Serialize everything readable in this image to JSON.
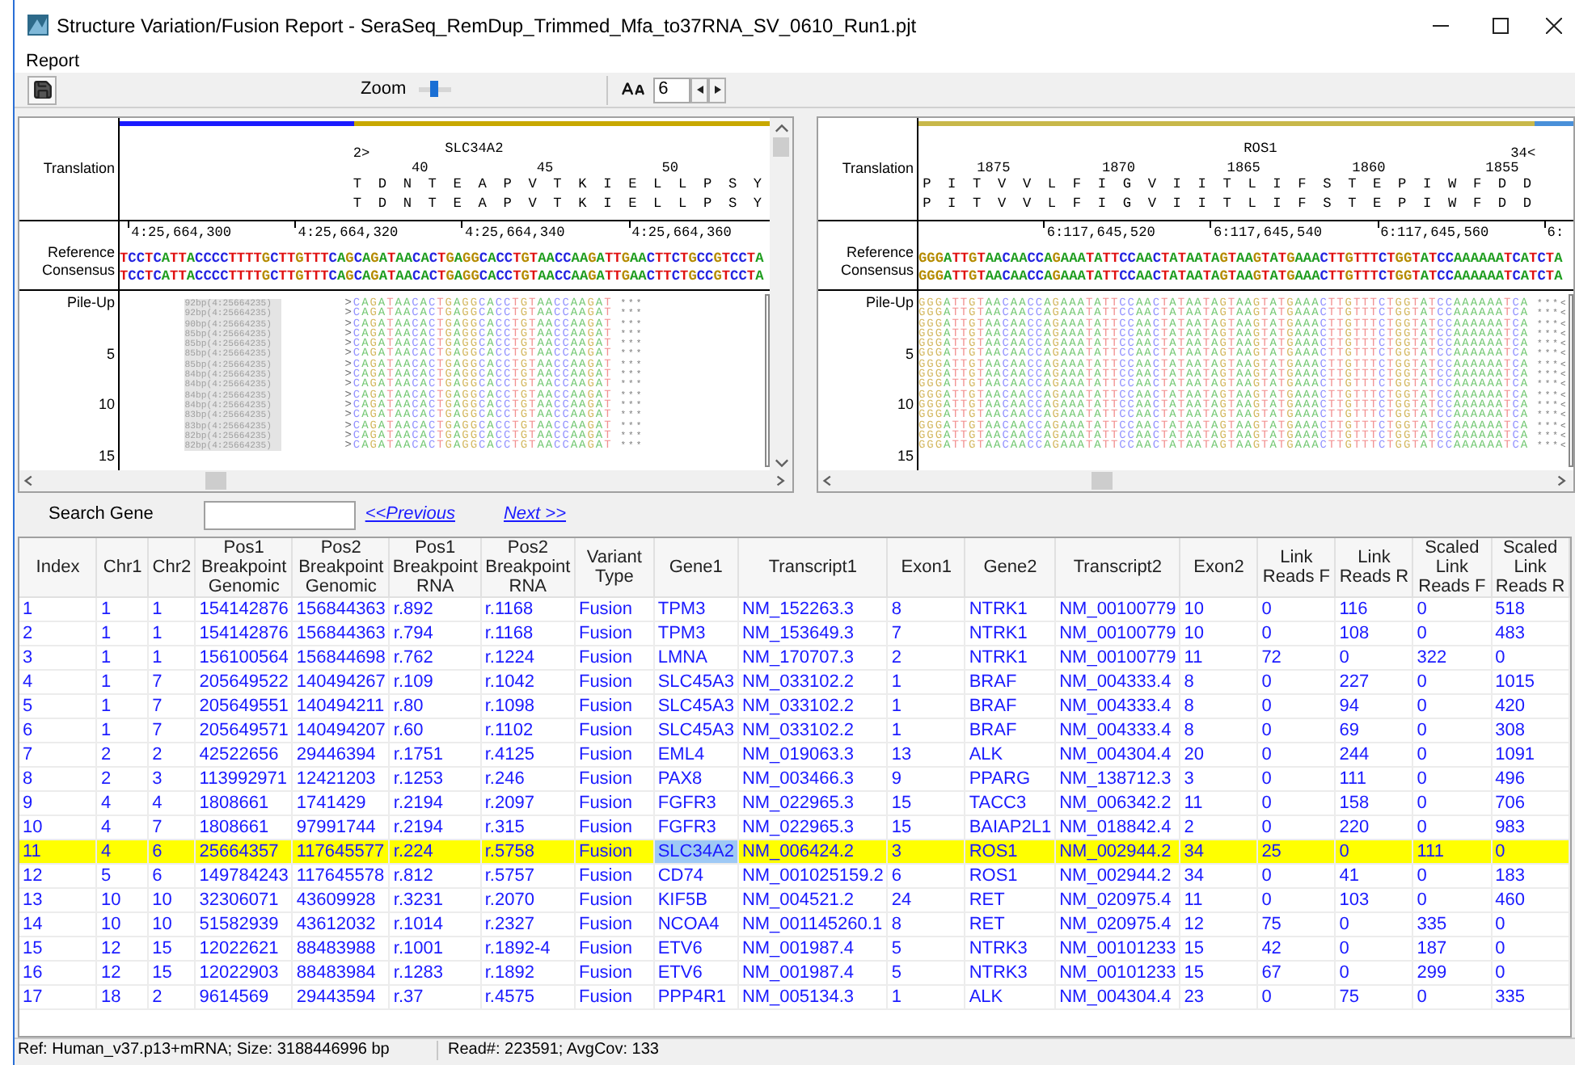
{
  "window": {
    "title": "Structure Variation/Fusion Report - SeraSeq_RemDup_Trimmed_Mfa_to37RNA_SV_0610_Run1.pjt"
  },
  "menu": [
    "Report"
  ],
  "toolbar": {
    "zoom_label": "Zoom",
    "zoom": {
      "level": 0.45
    },
    "font_size": {
      "value": "6"
    }
  },
  "panels": [
    {
      "translation_label": "Translation",
      "coverage": [
        {
          "color": "#1a1aff",
          "level": 0.36
        },
        {
          "color": "#c8a800",
          "level": 0.64
        }
      ],
      "marker": "2>",
      "gene": "SLC34A2",
      "numbers": [
        "40",
        "45",
        "50"
      ],
      "aa_rows": [
        "T D N T E A P V T K I E L L P S Y",
        "T D N T E A P V T K I E L L P S Y"
      ],
      "reference_label": "Reference",
      "consensus_label": "Consensus",
      "ruler": [
        "4:25,664,300",
        "4:25,664,320",
        "4:25,664,340",
        "4:25,664,360"
      ],
      "reference": "TCCTCATTACCCCTTTTGCTTGTTTCAGCAGATAACACTGAGGCACCTGTAACCAAGATTGAACTTCTGCCGTCCTA",
      "consensus": "TCCTCATTACCCCTTTTGCTTGTTTCAGCAGATAACACTGAGGCACCTGTAACCAAGATTGAACTTCTGCCGTCCTA",
      "pileup_label": "Pile-Up",
      "pileup_ticks": [
        "5",
        "10",
        "15"
      ],
      "reads": [
        {
          "label": "92bp(4:25664235)",
          "sequence": ">CAGATAACACTGAGGCACCTGTAACCAAGAT",
          "tail": "***"
        },
        {
          "label": "92bp(4:25664235)",
          "sequence": ">CAGATAACACTGAGGCACCTGTAACCAAGAT",
          "tail": "***"
        },
        {
          "label": "90bp(4:25664235)",
          "sequence": ">CAGATAACACTGAGGCACCTGTAACCAAGAT",
          "tail": "***"
        },
        {
          "label": "85bp(4:25664235)",
          "sequence": ">CAGATAACACTGAGGCACCTGTAACCAAGAT",
          "tail": "***"
        },
        {
          "label": "85bp(4:25664235)",
          "sequence": ">CAGATAACACTGAGGCACCTGTAACCAAGAT",
          "tail": "***"
        },
        {
          "label": "85bp(4:25664235)",
          "sequence": ">CAGATAACACTGAGGCACCTGTAACCAAGAT",
          "tail": "***"
        },
        {
          "label": "85bp(4:25664235)",
          "sequence": ">CAGATAACACTGAGGCACCTGTAACCAAGAT",
          "tail": "***"
        },
        {
          "label": "84bp(4:25664235)",
          "sequence": ">CAGATAACACTGAGGCACCTGTAACCAAGAT",
          "tail": "***"
        },
        {
          "label": "84bp(4:25664235)",
          "sequence": ">CAGATAACACTGAGGCACCTGTAACCAAGAT",
          "tail": "***"
        },
        {
          "label": "84bp(4:25664235)",
          "sequence": ">CAGATAACACTGAGGCACCTGTAACCAAGAT",
          "tail": "***"
        },
        {
          "label": "84bp(4:25664235)",
          "sequence": ">CAGATAACACTGAGGCACCTGTAACCAAGAT",
          "tail": "***"
        },
        {
          "label": "83bp(4:25664235)",
          "sequence": ">CAGATAACACTGAGGCACCTGTAACCAAGAT",
          "tail": "***"
        },
        {
          "label": "83bp(4:25664235)",
          "sequence": ">CAGATAACACTGAGGCACCTGTAACCAAGAT",
          "tail": "***"
        },
        {
          "label": "82bp(4:25664235)",
          "sequence": ">CAGATAACACTGAGGCACCTGTAACCAAGAT",
          "tail": "***"
        },
        {
          "label": "82bp(4:25664235)",
          "sequence": ">CAGATAACACTGAGGCACCTGTAACCAAGAT",
          "tail": "***"
        }
      ]
    },
    {
      "translation_label": "Translation",
      "coverage": [
        {
          "color": "#c8b84a",
          "level": 0.94
        },
        {
          "color": "#4a90d9",
          "level": 0.06
        }
      ],
      "gene": "ROS1",
      "end_marker": "34<",
      "numbers": [
        "1875",
        "1870",
        "1865",
        "1860",
        "1855"
      ],
      "aa_rows": [
        "P I T V V L F I G V I I T L I F S T E P I W F D D",
        "P I T V V L F I G V I I T L I F S T E P I W F D D"
      ],
      "reference_label": "Reference",
      "consensus_label": "Consensus",
      "ruler": [
        "6:117,645,520",
        "6:117,645,540",
        "6:117,645,560",
        "6:"
      ],
      "reference": "GGGATTGTAACAACCAGAAATATTCCAACTATAATAGTAAGTATGAAACTTGTTTCTGGTATCCAAAAAATCATCTA",
      "consensus": "GGGATTGTAACAACCAGAAATATTCCAACTATAATAGTAAGTATGAAACTTGTTTCTGGTATCCAAAAAATCATCTA",
      "pileup_label": "Pile-Up",
      "pileup_ticks": [
        "5",
        "10",
        "15"
      ],
      "reads": [
        {
          "sequence": "GGGATTGTAACAACCAGAAATATTCCAACTATAATAGTAAGTATGAAACTTGTTTCTGGTATCCAAAAAATCA",
          "tail": "***<"
        },
        {
          "sequence": "GGGATTGTAACAACCAGAAATATTCCAACTATAATAGTAAGTATGAAACTTGTTTCTGGTATCCAAAAAATCA",
          "tail": "***<"
        },
        {
          "sequence": "GGGATTGTAACAACCAGAAATATTCCAACTATAATAGTAAGTATGAAACTTGTTTCTGGTATCCAAAAAATCA",
          "tail": "***<"
        },
        {
          "sequence": "GGGATTGTAACAACCAGAAATATTCCAACTATAATAGTAAGTATGAAACTTGTTTCTGGTATCCAAAAAATCA",
          "tail": "***<"
        },
        {
          "sequence": "GGGATTGTAACAACCAGAAATATTCCAACTATAATAGTAAGTATGAAACTTGTTTCTGGTATCCAAAAAATCA",
          "tail": "***<"
        },
        {
          "sequence": "GGGATTGTAACAACCAGAAATATTCCAACTATAATAGTAAGTATGAAACTTGTTTCTGGTATCCAAAAAATCA",
          "tail": "***<"
        },
        {
          "sequence": "GGGATTGTAACAACCAGAAATATTCCAACTATAATAGTAAGTATGAAACTTGTTTCTGGTATCCAAAAAATCA",
          "tail": "***<"
        },
        {
          "sequence": "GGGATTGTAACAACCAGAAATATTCCAACTATAATAGTAAGTATGAAACTTGTTTCTGGTATCCAAAAAATCA",
          "tail": "***<"
        },
        {
          "sequence": "GGGATTGTAACAACCAGAAATATTCCAACTATAATAGTAAGTATGAAACTTGTTTCTGGTATCCAAAAAATCA",
          "tail": "***<"
        },
        {
          "sequence": "GGGATTGTAACAACCAGAAATATTCCAACTATAATAGTAAGTATGAAACTTGTTTCTGGTATCCAAAAAATCA",
          "tail": "***<"
        },
        {
          "sequence": "GGGATTGTAACAACCAGAAATATTCCAACTATAATAGTAAGTATGAAACTTGTTTCTGGTATCCAAAAAATCA",
          "tail": "***<"
        },
        {
          "sequence": "GGGATTGTAACAACCAGAAATATTCCAACTATAATAGTAAGTATGAAACTTGTTTCTGGTATCCAAAAAATCA",
          "tail": "***<"
        },
        {
          "sequence": "GGGATTGTAACAACCAGAAATATTCCAACTATAATAGTAAGTATGAAACTTGTTTCTGGTATCCAAAAAATCA",
          "tail": "***<"
        },
        {
          "sequence": "GGGATTGTAACAACCAGAAATATTCCAACTATAATAGTAAGTATGAAACTTGTTTCTGGTATCCAAAAAATCA",
          "tail": "***<"
        },
        {
          "sequence": "GGGATTGTAACAACCAGAAATATTCCAACTATAATAGTAAGTATGAAACTTGTTTCTGGTATCCAAAAAATCA",
          "tail": "***<"
        }
      ]
    }
  ],
  "search": {
    "label": "Search Gene",
    "previous": "<<Previous",
    "next": "Next >>"
  },
  "table": {
    "columns": [
      "Index",
      "Chr1",
      "Chr2",
      "Pos1\nBreakpoint\nGenomic",
      "Pos2\nBreakpoint\nGenomic",
      "Pos1\nBreakpoint\nRNA",
      "Pos2\nBreakpoint\nRNA",
      "Variant\nType",
      "Gene1",
      "Transcript1",
      "Exon1",
      "Gene2",
      "Transcript2",
      "Exon2",
      "Link\nReads F",
      "Link\nReads R",
      "Scaled\nLink\nReads F",
      "Scaled\nLink\nReads R"
    ],
    "rows": [
      {
        "selected": false,
        "cells": [
          "1",
          "1",
          "1",
          "154142876",
          "156844363",
          "r.892",
          "r.1168",
          "Fusion",
          "TPM3",
          "NM_152263.3",
          "8",
          "NTRK1",
          "NM_00100779",
          "10",
          "0",
          "116",
          "0",
          "518"
        ]
      },
      {
        "selected": false,
        "cells": [
          "2",
          "1",
          "1",
          "154142876",
          "156844363",
          "r.794",
          "r.1168",
          "Fusion",
          "TPM3",
          "NM_153649.3",
          "7",
          "NTRK1",
          "NM_00100779",
          "10",
          "0",
          "108",
          "0",
          "483"
        ]
      },
      {
        "selected": false,
        "cells": [
          "3",
          "1",
          "1",
          "156100564",
          "156844698",
          "r.762",
          "r.1224",
          "Fusion",
          "LMNA",
          "NM_170707.3",
          "2",
          "NTRK1",
          "NM_00100779",
          "11",
          "72",
          "0",
          "322",
          "0"
        ]
      },
      {
        "selected": false,
        "cells": [
          "4",
          "1",
          "7",
          "205649522",
          "140494267",
          "r.109",
          "r.1042",
          "Fusion",
          "SLC45A3",
          "NM_033102.2",
          "1",
          "BRAF",
          "NM_004333.4",
          "8",
          "0",
          "227",
          "0",
          "1015"
        ]
      },
      {
        "selected": false,
        "cells": [
          "5",
          "1",
          "7",
          "205649551",
          "140494211",
          "r.80",
          "r.1098",
          "Fusion",
          "SLC45A3",
          "NM_033102.2",
          "1",
          "BRAF",
          "NM_004333.4",
          "8",
          "0",
          "94",
          "0",
          "420"
        ]
      },
      {
        "selected": false,
        "cells": [
          "6",
          "1",
          "7",
          "205649571",
          "140494207",
          "r.60",
          "r.1102",
          "Fusion",
          "SLC45A3",
          "NM_033102.2",
          "1",
          "BRAF",
          "NM_004333.4",
          "8",
          "0",
          "69",
          "0",
          "308"
        ]
      },
      {
        "selected": false,
        "cells": [
          "7",
          "2",
          "2",
          "42522656",
          "29446394",
          "r.1751",
          "r.4125",
          "Fusion",
          "EML4",
          "NM_019063.3",
          "13",
          "ALK",
          "NM_004304.4",
          "20",
          "0",
          "244",
          "0",
          "1091"
        ]
      },
      {
        "selected": false,
        "cells": [
          "8",
          "2",
          "3",
          "113992971",
          "12421203",
          "r.1253",
          "r.246",
          "Fusion",
          "PAX8",
          "NM_003466.3",
          "9",
          "PPARG",
          "NM_138712.3",
          "3",
          "0",
          "111",
          "0",
          "496"
        ]
      },
      {
        "selected": false,
        "cells": [
          "9",
          "4",
          "4",
          "1808661",
          "1741429",
          "r.2194",
          "r.2097",
          "Fusion",
          "FGFR3",
          "NM_022965.3",
          "15",
          "TACC3",
          "NM_006342.2",
          "11",
          "0",
          "158",
          "0",
          "706"
        ]
      },
      {
        "selected": false,
        "cells": [
          "10",
          "4",
          "7",
          "1808661",
          "97991744",
          "r.2194",
          "r.315",
          "Fusion",
          "FGFR3",
          "NM_022965.3",
          "15",
          "BAIAP2L1",
          "NM_018842.4",
          "2",
          "0",
          "220",
          "0",
          "983"
        ]
      },
      {
        "selected": true,
        "gene1_focused": true,
        "cells": [
          "11",
          "4",
          "6",
          "25664357",
          "117645577",
          "r.224",
          "r.5758",
          "Fusion",
          "SLC34A2",
          "NM_006424.2",
          "3",
          "ROS1",
          "NM_002944.2",
          "34",
          "25",
          "0",
          "111",
          "0"
        ]
      },
      {
        "selected": false,
        "cells": [
          "12",
          "5",
          "6",
          "149784243",
          "117645578",
          "r.812",
          "r.5757",
          "Fusion",
          "CD74",
          "NM_001025159.2",
          "6",
          "ROS1",
          "NM_002944.2",
          "34",
          "0",
          "41",
          "0",
          "183"
        ]
      },
      {
        "selected": false,
        "cells": [
          "13",
          "10",
          "10",
          "32306071",
          "43609928",
          "r.3231",
          "r.2070",
          "Fusion",
          "KIF5B",
          "NM_004521.2",
          "24",
          "RET",
          "NM_020975.4",
          "11",
          "0",
          "103",
          "0",
          "460"
        ]
      },
      {
        "selected": false,
        "cells": [
          "14",
          "10",
          "10",
          "51582939",
          "43612032",
          "r.1014",
          "r.2327",
          "Fusion",
          "NCOA4",
          "NM_001145260.1",
          "8",
          "RET",
          "NM_020975.4",
          "12",
          "75",
          "0",
          "335",
          "0"
        ]
      },
      {
        "selected": false,
        "cells": [
          "15",
          "12",
          "15",
          "12022621",
          "88483988",
          "r.1001",
          "r.1892-4",
          "Fusion",
          "ETV6",
          "NM_001987.4",
          "5",
          "NTRK3",
          "NM_00101233",
          "15",
          "42",
          "0",
          "187",
          "0"
        ]
      },
      {
        "selected": false,
        "cells": [
          "16",
          "12",
          "15",
          "12022903",
          "88483984",
          "r.1283",
          "r.1892",
          "Fusion",
          "ETV6",
          "NM_001987.4",
          "5",
          "NTRK3",
          "NM_00101233",
          "15",
          "67",
          "0",
          "299",
          "0"
        ]
      },
      {
        "selected": false,
        "cells": [
          "17",
          "18",
          "2",
          "9614569",
          "29443594",
          "r.37",
          "r.4575",
          "Fusion",
          "PPP4R1",
          "NM_005134.3",
          "1",
          "ALK",
          "NM_004304.4",
          "23",
          "0",
          "75",
          "0",
          "335"
        ]
      }
    ]
  },
  "status_bar": [
    "Ref: Human_v37.p13+mRNA; Size: 3188446996 bp",
    "Read#: 223591; AvgCov: 133"
  ]
}
